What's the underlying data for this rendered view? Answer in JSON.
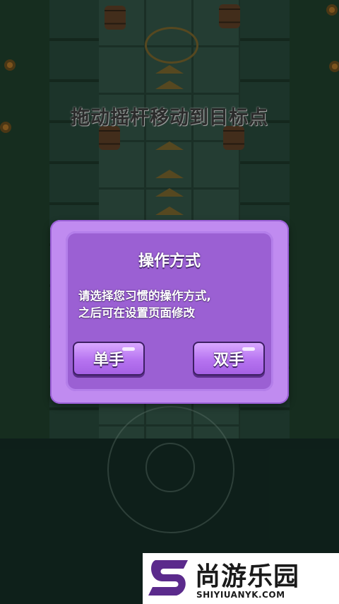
{
  "hint": {
    "text": "拖动摇杆移动到目标点"
  },
  "dialog": {
    "title": "操作方式",
    "message_line1": "请选择您习惯的操作方式,",
    "message_line2": "之后可在设置页面修改",
    "single_hand_label": "单手",
    "two_hand_label": "双手"
  },
  "watermark": {
    "brand": "尚游乐园",
    "url": "SHIYIUANYK.COM"
  },
  "colors": {
    "dialog_outer": "#c08bf0",
    "dialog_inner": "#9b60d3",
    "button": "#b673f0",
    "logo_purple": "#5b2a8c"
  },
  "icons": [
    "joystick-icon",
    "target-ring-icon",
    "path-arrow-icon",
    "barrel-icon",
    "flower-icon"
  ]
}
